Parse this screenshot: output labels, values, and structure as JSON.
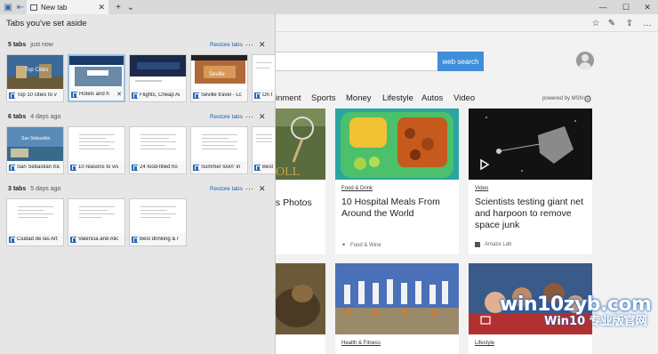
{
  "browser": {
    "tab_title": "New tab",
    "tab_close": "✕",
    "new_tab": "+",
    "tab_menu": "⌄",
    "window": {
      "minimize": "—",
      "maximize": "☐",
      "close": "✕"
    }
  },
  "toolbar": {
    "favorites": "☆",
    "reading": "✎",
    "share": "⇪",
    "more": "…"
  },
  "search": {
    "placeholder": "",
    "button": "web search"
  },
  "categories": [
    "inment",
    "Sports",
    "Money",
    "Lifestyle",
    "Autos",
    "Video"
  ],
  "powered_by": "powered by MSN",
  "cards": [
    {
      "tag": "",
      "title": "ts Photos",
      "source": ""
    },
    {
      "tag": "Food & Drink",
      "title": "10 Hospital Meals From Around the World",
      "source": "Food & Wine"
    },
    {
      "tag": "Video",
      "title": "Scientists testing giant net and harpoon to remove space junk",
      "source": "Amaze Lab"
    },
    {
      "tag": "Health & Fitness",
      "title": "",
      "source": ""
    },
    {
      "tag": "Lifestyle",
      "title": "",
      "source": ""
    }
  ],
  "panel": {
    "title": "Tabs you've set aside",
    "restore_label": "Restore tabs",
    "more": "···",
    "close": "✕",
    "groups": [
      {
        "count": "5 tabs",
        "when": "just now",
        "tabs": [
          "Top 10 cities to v",
          "Hotels and h",
          "Flights, Cheap Ai",
          "Seville travel - Lc",
          "On t"
        ],
        "shot_texts": [
          "Top Cities",
          "",
          "",
          "Seville",
          ""
        ]
      },
      {
        "count": "6 tabs",
        "when": "4 days ago",
        "tabs": [
          "San Sebastián tra",
          "10 reasons to vis",
          "24 food-filled ho",
          "Summer lovin' in",
          "Best"
        ],
        "shot_texts": [
          "San Sebastián",
          "",
          "",
          "",
          ""
        ]
      },
      {
        "count": "3 tabs",
        "when": "5 days ago",
        "tabs": [
          "Ciudad de las Art",
          "Valencia and Alic",
          "Best drinking & r"
        ]
      }
    ]
  },
  "watermark": {
    "line1": "win10zyb.com",
    "line2": "Win10 专业版官网"
  }
}
